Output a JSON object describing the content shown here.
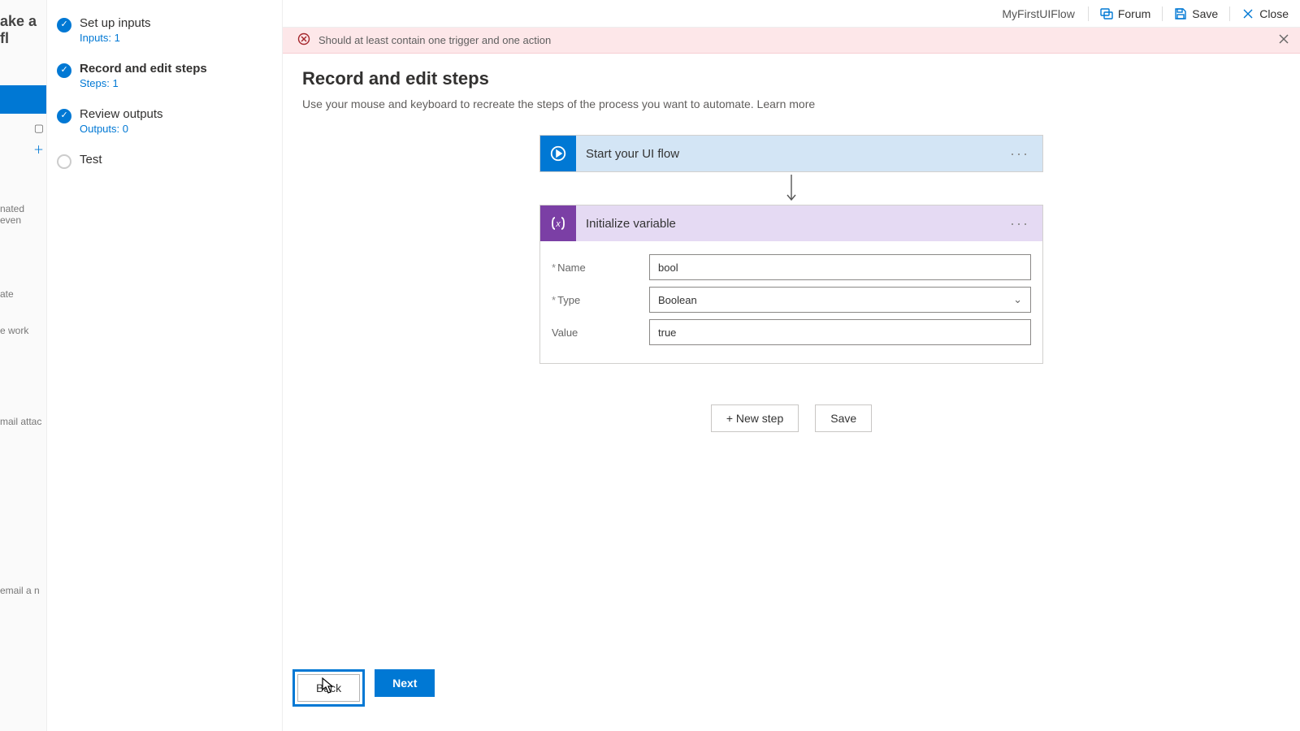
{
  "bg": {
    "heading": "ake a fl",
    "item1": "nated even",
    "item2": "ate",
    "item3": "e work",
    "item4": "mail attac",
    "item5": "email a n"
  },
  "wizard": {
    "steps": [
      {
        "title": "Set up inputs",
        "sub": "Inputs: 1"
      },
      {
        "title": "Record and edit steps",
        "sub": "Steps: 1"
      },
      {
        "title": "Review outputs",
        "sub": "Outputs: 0"
      },
      {
        "title": "Test",
        "sub": ""
      }
    ]
  },
  "topbar": {
    "name": "MyFirstUIFlow",
    "forum": "Forum",
    "save": "Save",
    "close": "Close"
  },
  "banner": {
    "msg": "Should at least contain one trigger and one action"
  },
  "page": {
    "title": "Record and edit steps",
    "desc": "Use your mouse and keyboard to recreate the steps of the process you want to automate.  ",
    "learn": "Learn more"
  },
  "nodes": {
    "start": "Start your UI flow",
    "init": "Initialize variable",
    "fields": {
      "name_label": "Name",
      "name_value": "bool",
      "type_label": "Type",
      "type_value": "Boolean",
      "value_label": "Value",
      "value_value": "true"
    }
  },
  "actions": {
    "newstep": "New step",
    "save": "Save"
  },
  "footer": {
    "back": "Back",
    "next": "Next"
  }
}
